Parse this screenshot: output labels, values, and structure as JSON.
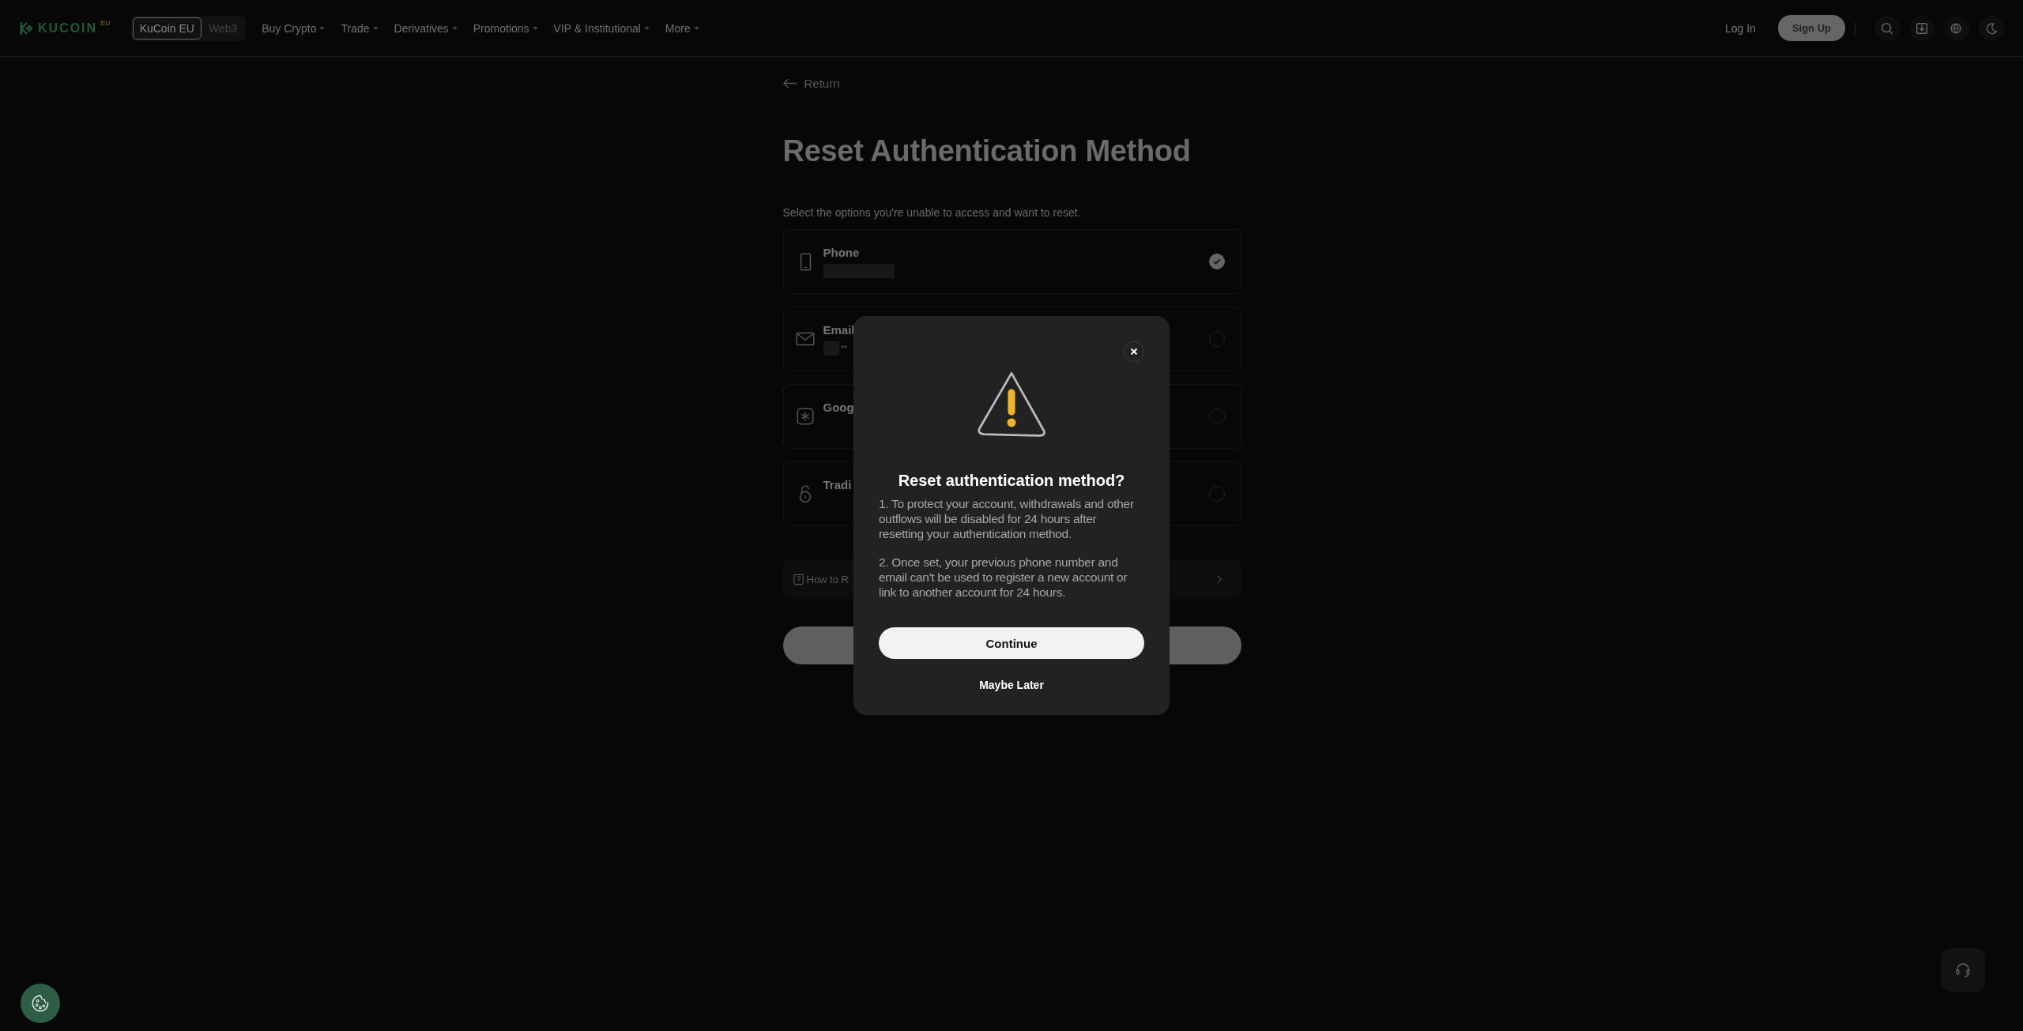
{
  "header": {
    "logo": "KUCOIN",
    "logo_suffix": "EU",
    "site_tabs": [
      {
        "label": "KuCoin EU",
        "selected": true
      },
      {
        "label": "Web3",
        "selected": false
      }
    ],
    "nav": [
      {
        "label": "Buy Crypto"
      },
      {
        "label": "Trade"
      },
      {
        "label": "Derivatives"
      },
      {
        "label": "Promotions"
      },
      {
        "label": "VIP & Institutional"
      },
      {
        "label": "More"
      }
    ],
    "login": "Log In",
    "signup": "Sign Up"
  },
  "page": {
    "return": "Return",
    "title": "Reset Authentication Method",
    "subtitle": "Select the options you're unable to access and want to reset.",
    "options": [
      {
        "kind": "phone",
        "label": "Phone",
        "masked": true,
        "checked": true
      },
      {
        "kind": "email",
        "label": "Email",
        "masked": true,
        "value": "**",
        "checked": false
      },
      {
        "kind": "authenticator",
        "label": "Goog",
        "masked": false,
        "checked": false
      },
      {
        "kind": "lock",
        "label": "Tradi",
        "masked": false,
        "checked": false
      }
    ],
    "help_link": "How to R"
  },
  "modal": {
    "title": "Reset authentication method?",
    "paragraphs": [
      "1. To protect your account, withdrawals and other outflows will be disabled for 24 hours after resetting your authentication method.",
      "2. Once set, your previous phone number and email can't be used to register a new account or link to another account for 24 hours."
    ],
    "primary": "Continue",
    "secondary": "Maybe Later"
  }
}
